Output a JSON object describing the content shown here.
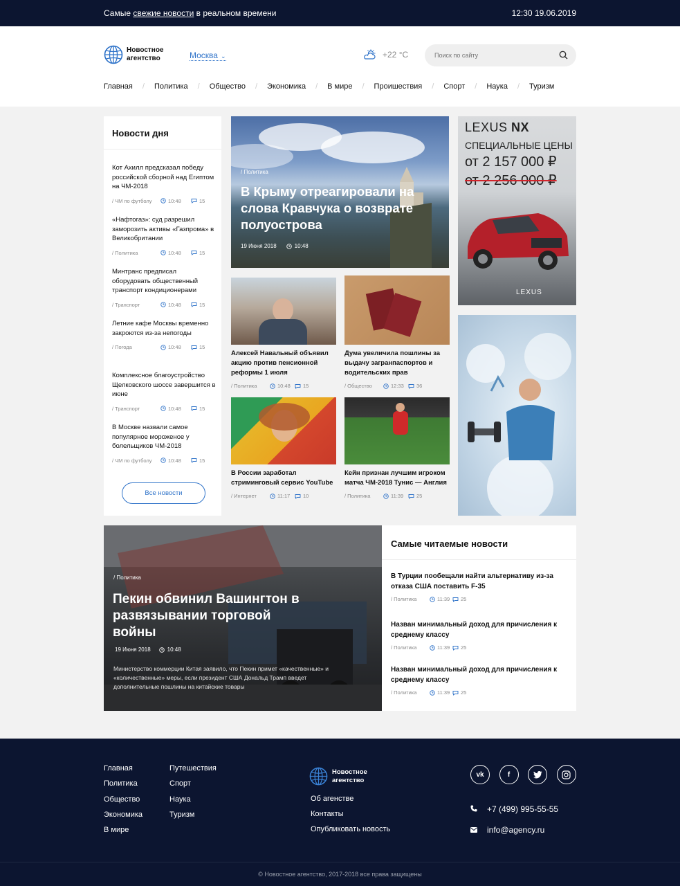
{
  "topbar": {
    "tagline_pre": "Самые ",
    "tagline_link": "свежие новости",
    "tagline_post": " в реальном времени",
    "datetime": "12:30 19.06.2019"
  },
  "header": {
    "logo_name": "Новостное агентство",
    "city": "Москва",
    "weather": "+22 °C",
    "search_placeholder": "Поиск по сайту",
    "nav": [
      "Главная",
      "Политика",
      "Общество",
      "Экономика",
      "В мире",
      "Проишествия",
      "Спорт",
      "Наука",
      "Туризм"
    ]
  },
  "day_news": {
    "title": "Новости дня",
    "items": [
      {
        "text": "Кот Ахилл предсказал победу российской сборной над Египтом на ЧМ-2018",
        "category": "/ ЧМ по футболу",
        "time": "10:48",
        "comments": "15"
      },
      {
        "text": "«Нафтогаз»: суд разрешил заморозить активы «Газпрома» в Великобритании",
        "category": "/ Политика",
        "time": "10:48",
        "comments": "15"
      },
      {
        "text": "Минтранс предписал оборудовать общественный транспорт кондиционерами",
        "category": "/ Транспорт",
        "time": "10:48",
        "comments": "15"
      },
      {
        "text": "Летние кафе Москвы временно закроются из-за непогоды",
        "category": "/ Погода",
        "time": "10:48",
        "comments": "15"
      },
      {
        "text": "Комплексное благоустройство Щелковского шоссе завершится в июне",
        "category": "/ Транспорт",
        "time": "10:48",
        "comments": "15"
      },
      {
        "text": "В Москве назвали самое популярное мороженое у болельщиков ЧМ-2018",
        "category": "/ ЧМ по футболу",
        "time": "10:48",
        "comments": "15"
      }
    ],
    "all_button": "Все новости"
  },
  "feature": {
    "category": "/ Политика",
    "headline": "В Крыму отреагировали на слова Кравчука о возврате полуострова",
    "date": "19 Июня 2018",
    "time": "10:48"
  },
  "cards": [
    {
      "title": "Алексей Навальный объявил акцию против пенсионной реформы 1 июля",
      "category": "/ Политика",
      "time": "10:48",
      "comments": "15"
    },
    {
      "title": "Дума увеличила пошлины за выдачу загранпаспортов и водительских прав",
      "category": "/ Общество",
      "time": "12:33",
      "comments": "36"
    },
    {
      "title": "В России заработал стриминговый сервис YouTube",
      "category": "/ Интернет",
      "time": "11:17",
      "comments": "10"
    },
    {
      "title": "Кейн признан лучшим игроком матча ЧМ-2018 Тунис — Англия",
      "category": "/ Политика",
      "time": "11:39",
      "comments": "25"
    }
  ],
  "ad_lexus": {
    "model_a": "LEXUS ",
    "model_b": "NX",
    "line2": "СПЕЦИАЛЬНЫЕ ЦЕНЫ",
    "price_new": "от 2 157 000 ₽",
    "price_old": "от 2 256 000 ₽",
    "brand": "LEXUS"
  },
  "big_story": {
    "category": "/ Политика",
    "headline": "Пекин обвинил Вашингтон в развязывании торговой войны",
    "date": "19 Июня 2018",
    "time": "10:48",
    "lead": "Министерство коммерции Китая заявило, что Пекин примет «качественные» и «количественные» меры, если президент США Дональд Трамп введет дополнительные пошлины на китайские товары"
  },
  "popular": {
    "title": "Самые читаемые новости",
    "items": [
      {
        "text": "В Турции пообещали найти альтернативу из-за отказа США поставить F-35",
        "category": "/ Политика",
        "time": "11:39",
        "comments": "25"
      },
      {
        "text": "Назван минимальный доход для причисления к среднему классу",
        "category": "/ Политика",
        "time": "11:39",
        "comments": "25"
      },
      {
        "text": "Назван минимальный доход для причисления к среднему классу",
        "category": "/ Политика",
        "time": "11:39",
        "comments": "25"
      }
    ]
  },
  "footer": {
    "col1": [
      "Главная",
      "Политика",
      "Общество",
      "Экономика",
      "В мире"
    ],
    "col2": [
      "Путешествия",
      "Спорт",
      "Наука",
      "Туризм"
    ],
    "logo_name": "Новостное агентство",
    "links": [
      "Об агенстве",
      "Контакты",
      "Опубликовать новость"
    ],
    "socials": [
      "vk-icon",
      "facebook-icon",
      "twitter-icon",
      "instagram-icon"
    ],
    "phone": "+7 (499) 995-55-55",
    "email": "info@agency.ru",
    "copyright": "© Новостное агентство, 2017-2018 все права защищены"
  }
}
